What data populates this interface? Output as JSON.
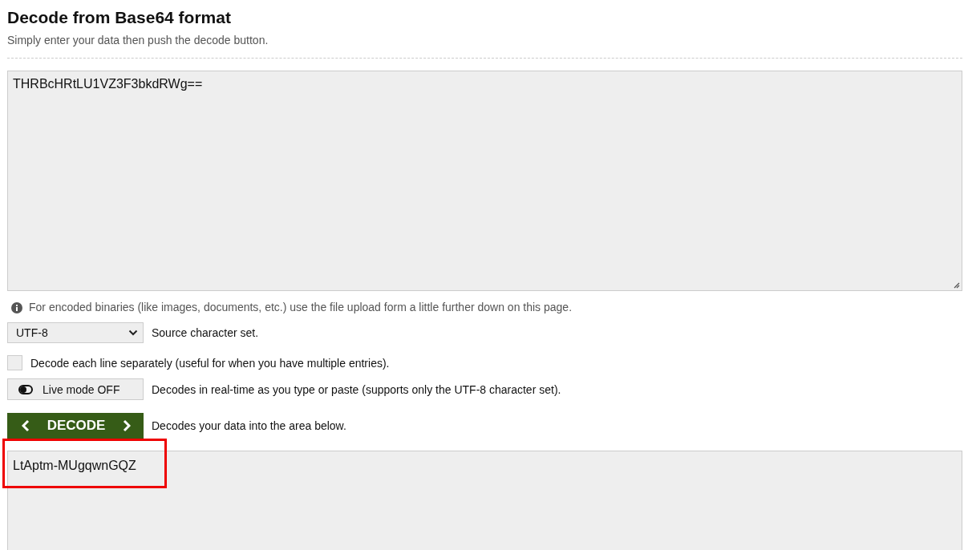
{
  "title": "Decode from Base64 format",
  "subtitle": "Simply enter your data then push the decode button.",
  "input": {
    "value": "THRBcHRtLU1VZ3F3bkdRWg=="
  },
  "info_note": "For encoded binaries (like images, documents, etc.) use the file upload form a little further down on this page.",
  "charset": {
    "value": "UTF-8",
    "label": "Source character set."
  },
  "each_line": {
    "checked": false,
    "label": "Decode each line separately (useful for when you have multiple entries)."
  },
  "live_mode": {
    "on": false,
    "button": "Live mode OFF",
    "label": "Decodes in real-time as you type or paste (supports only the UTF-8 character set)."
  },
  "decode": {
    "button": "DECODE",
    "label": "Decodes your data into the area below."
  },
  "output": {
    "value": "LtAptm-MUgqwnGQZ",
    "highlighted": true
  }
}
